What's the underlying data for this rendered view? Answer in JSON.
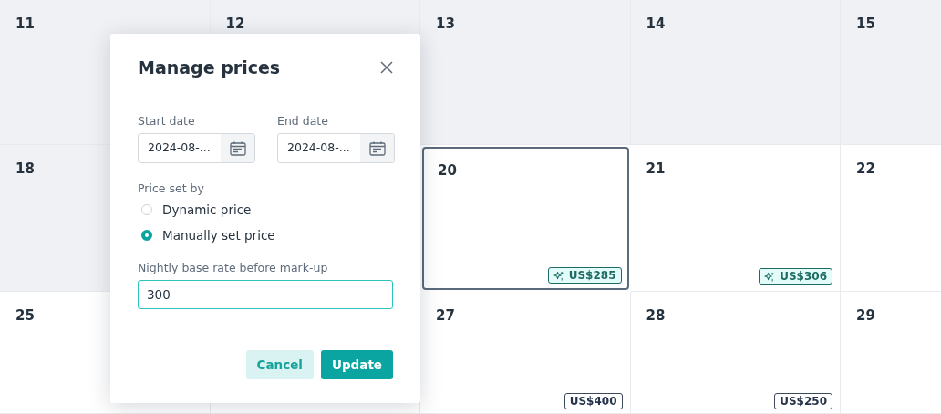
{
  "calendar": {
    "cells": [
      {
        "day": "11",
        "past": true,
        "selected": false
      },
      {
        "day": "12",
        "past": true,
        "selected": false
      },
      {
        "day": "13",
        "past": true,
        "selected": false
      },
      {
        "day": "14",
        "past": true,
        "selected": false
      },
      {
        "day": "15",
        "past": true,
        "selected": false
      },
      {
        "day": "18",
        "past": true,
        "selected": false
      },
      {},
      {
        "day": "20",
        "past": false,
        "selected": true,
        "price": {
          "kind": "dynamic",
          "text": "US$285"
        }
      },
      {
        "day": "21",
        "past": false,
        "selected": false,
        "price": {
          "kind": "dynamic",
          "text": "US$306"
        }
      },
      {
        "day": "22",
        "past": false,
        "selected": false
      },
      {
        "day": "25",
        "past": false,
        "selected": false
      },
      {
        "past": false,
        "selected": false
      },
      {
        "day": "27",
        "past": false,
        "selected": false,
        "price": {
          "kind": "manual",
          "text": "US$400"
        }
      },
      {
        "day": "28",
        "past": false,
        "selected": false,
        "price": {
          "kind": "manual",
          "text": "US$250"
        }
      },
      {
        "day": "29",
        "past": false,
        "selected": false
      }
    ]
  },
  "dialog": {
    "title": "Manage prices",
    "start_date": {
      "label": "Start date",
      "value": "2024-08-..."
    },
    "end_date": {
      "label": "End date",
      "value": "2024-08-..."
    },
    "price_set_by": {
      "label": "Price set by",
      "options": [
        {
          "label": "Dynamic price",
          "selected": false
        },
        {
          "label": "Manually set price",
          "selected": true
        }
      ]
    },
    "base_rate": {
      "label": "Nightly base rate before mark-up",
      "value": "300"
    },
    "buttons": [
      {
        "kind": "secondary",
        "label": "Cancel"
      },
      {
        "kind": "primary",
        "label": "Update"
      }
    ]
  }
}
